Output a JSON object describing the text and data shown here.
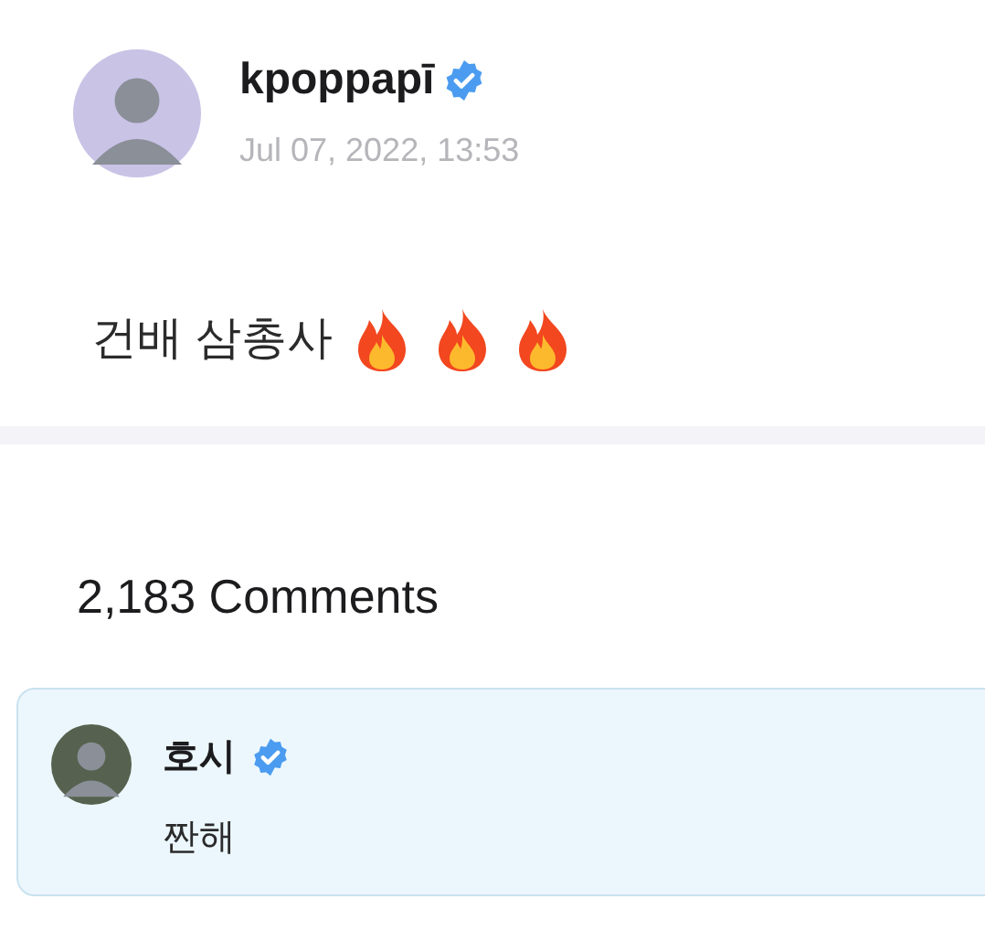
{
  "post": {
    "author": "kpoppapī",
    "verified": true,
    "date": "Jul 07, 2022, 13:53",
    "text": "건배 삼총사",
    "emoji": [
      {
        "kind": "fire"
      },
      {
        "kind": "fire"
      },
      {
        "kind": "fire"
      }
    ]
  },
  "comments_header": "2,183 Comments",
  "comments": [
    {
      "author": "호시",
      "verified": true,
      "text": "짠해"
    }
  ]
}
